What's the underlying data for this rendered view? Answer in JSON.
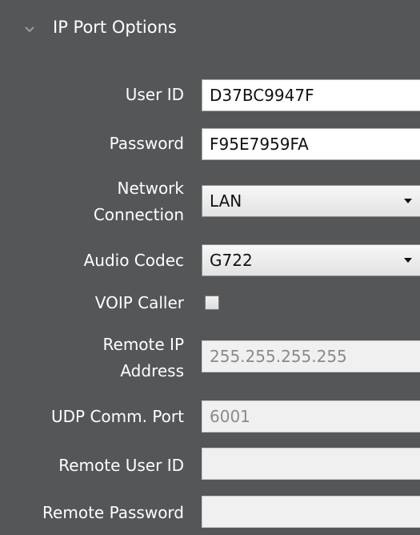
{
  "section": {
    "title": "IP Port Options",
    "icon": "chevron-down-icon",
    "expanded": true
  },
  "fields": {
    "user_id": {
      "label": "User ID",
      "value": "D37BC9947F"
    },
    "password": {
      "label": "Password",
      "value": "F95E7959FA"
    },
    "network_connection": {
      "label_line1": "Network",
      "label_line2": "Connection",
      "value": "LAN"
    },
    "audio_codec": {
      "label": "Audio Codec",
      "value": "G722"
    },
    "voip_caller": {
      "label": "VOIP Caller",
      "checked": false
    },
    "remote_ip": {
      "label_line1": "Remote IP",
      "label_line2": "Address",
      "value": "255.255.255.255"
    },
    "udp_port": {
      "label": "UDP Comm. Port",
      "value": "6001"
    },
    "remote_user_id": {
      "label": "Remote User ID",
      "value": ""
    },
    "remote_password": {
      "label": "Remote Password",
      "value": ""
    }
  },
  "colors": {
    "panel_background": "#555658",
    "label_text": "#ffffff",
    "input_background": "#ffffff",
    "disabled_input_background": "#f0f0f0",
    "disabled_text": "#8a8a8a"
  }
}
